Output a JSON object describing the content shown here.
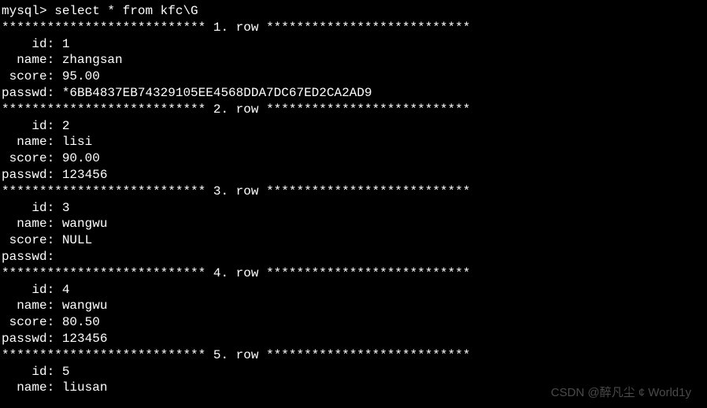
{
  "prompt": "mysql> ",
  "command": "select * from kfc\\G",
  "separator_prefix": "*************************** ",
  "separator_suffix": " ***************************",
  "row_label": ". row",
  "field_labels": {
    "id": "    id: ",
    "name": "  name: ",
    "score": " score: ",
    "passwd": "passwd: "
  },
  "rows": [
    {
      "num": "1",
      "id": "1",
      "name": "zhangsan",
      "score": "95.00",
      "passwd": "*6BB4837EB74329105EE4568DDA7DC67ED2CA2AD9"
    },
    {
      "num": "2",
      "id": "2",
      "name": "lisi",
      "score": "90.00",
      "passwd": "123456"
    },
    {
      "num": "3",
      "id": "3",
      "name": "wangwu",
      "score": "NULL",
      "passwd": ""
    },
    {
      "num": "4",
      "id": "4",
      "name": "wangwu",
      "score": "80.50",
      "passwd": "123456"
    },
    {
      "num": "5",
      "id": "5",
      "name": "liusan",
      "score": null,
      "passwd": null
    }
  ],
  "watermark": "CSDN @醉凡尘 ¢ World1y",
  "watermark2": ""
}
